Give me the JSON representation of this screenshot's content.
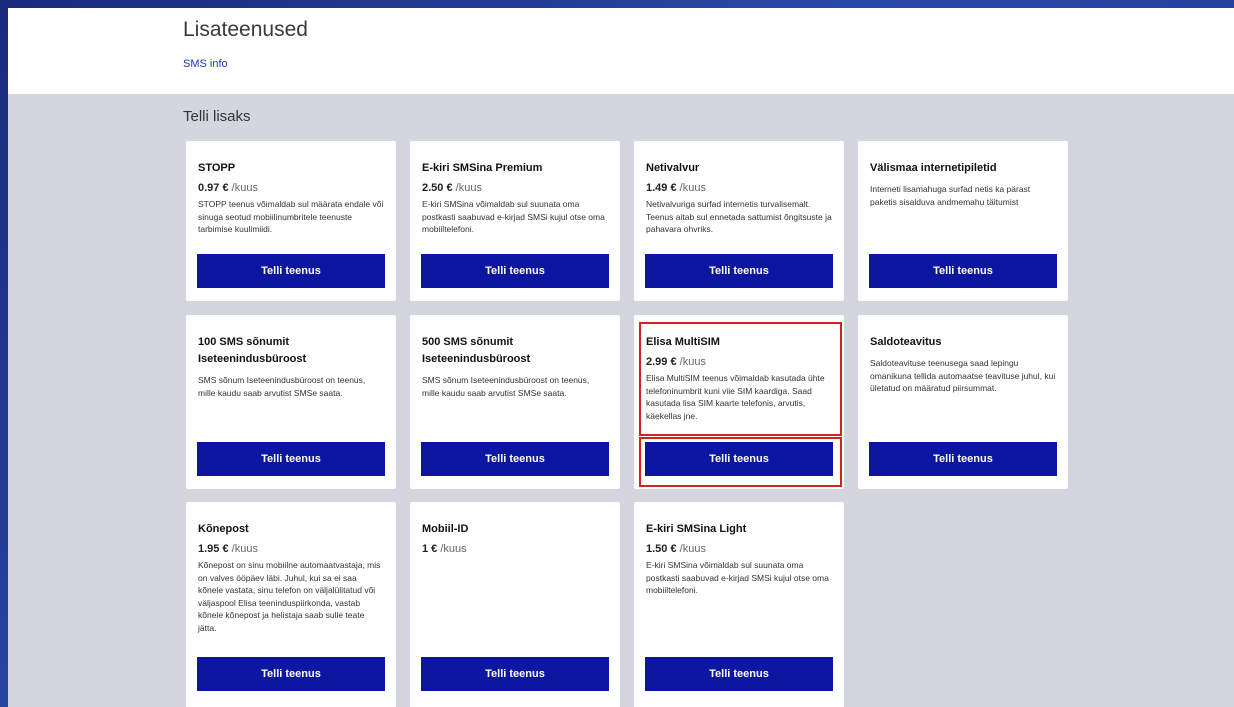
{
  "header": {
    "title": "Lisateenused",
    "sms_link": "SMS info"
  },
  "section": {
    "title": "Telli lisaks"
  },
  "unit": "/kuus",
  "cards": [
    {
      "title": "STOPP",
      "price": "0.97 €",
      "desc": "STOPP teenus võimaldab sul määrata endale või sinuga seotud mobiilinumbritele teenuste tarbimise kuulimiidi.",
      "button": "Telli teenus"
    },
    {
      "title": "E-kiri SMSina Premium",
      "price": "2.50 €",
      "desc": "E-kiri SMSina võimaldab sul suunata oma postkasti saabuvad e-kirjad SMSi kujul otse oma mobiiltelefoni.",
      "button": "Telli teenus"
    },
    {
      "title": "Netivalvur",
      "price": "1.49 €",
      "desc": "Netivalvuriga surfad internetis turvalisemalt. Teenus aitab sul ennetada sattumist õngitsuste ja pahavara ohvriks.",
      "button": "Telli teenus"
    },
    {
      "title": "Välismaa internetipiletid",
      "price": "",
      "desc": "Interneti lisamahuga surfad netis ka pärast paketis sisalduva andmemahu täitumist",
      "button": "Telli teenus"
    },
    {
      "title": "100 SMS sõnumit Iseteenindusbüroost",
      "price": "",
      "desc": "SMS sõnum Iseteenindusbüroost on teenus, mille kaudu saab arvutist SMSe saata.",
      "button": "Telli teenus"
    },
    {
      "title": "500 SMS sõnumit Iseteenindusbüroost",
      "price": "",
      "desc": "SMS sõnum Iseteenindusbüroost on teenus, mille kaudu saab arvutist SMSe saata.",
      "button": "Telli teenus"
    },
    {
      "title": "Elisa MultiSIM",
      "price": "2.99 €",
      "desc": "Elisa MultiSIM teenus võimaldab kasutada ühte telefoninumbrit kuni viie SIM kaardiga. Saad kasutada lisa SIM kaarte telefonis, arvutis, käekellas jne.",
      "button": "Telli teenus"
    },
    {
      "title": "Saldoteavitus",
      "price": "",
      "desc": "Saldoteavituse teenusega saad lepingu omanikuna tellida automaatse teavituse juhul, kui ületatud on määratud piirsummat.",
      "button": "Telli teenus"
    },
    {
      "title": "Kõnepost",
      "price": "1.95 €",
      "desc": "Kõnepost on sinu mobiilne automaatvastaja, mis on valves ööpäev läbi. Juhul, kui sa ei saa kõnele vastata, sinu telefon on väljalülitatud või väljaspool Elisa teeninduspiirkonda, vastab kõnele kõnepost ja helistaja saab sulle teate jätta.",
      "button": "Telli teenus"
    },
    {
      "title": "Mobiil-ID",
      "price": "1 €",
      "desc": "",
      "button": "Telli teenus"
    },
    {
      "title": "E-kiri SMSina Light",
      "price": "1.50 €",
      "desc": "E-kiri SMSina võimaldab sul suunata oma postkasti saabuvad e-kirjad SMSi kujul otse oma mobiiltelefoni.",
      "button": "Telli teenus"
    }
  ],
  "colors": {
    "button_bg": "#0d16a0",
    "link": "#1a35c8",
    "highlight": "#d42020",
    "page_bg": "#d3d6de"
  }
}
